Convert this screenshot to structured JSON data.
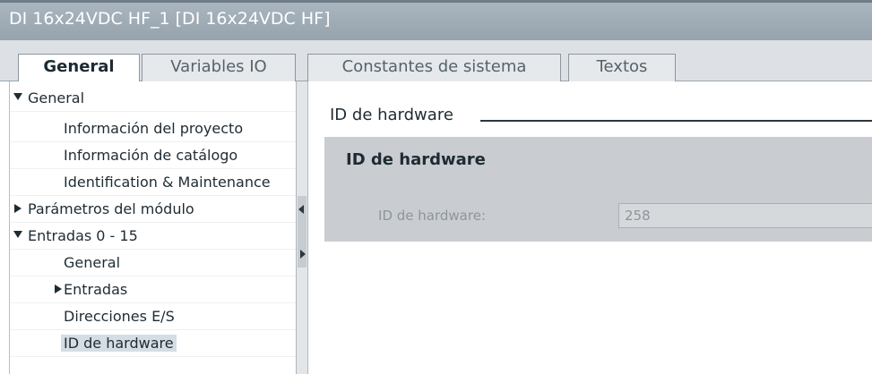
{
  "window": {
    "title": "DI 16x24VDC HF_1 [DI 16x24VDC HF]"
  },
  "tabs": [
    {
      "label": "General",
      "active": true
    },
    {
      "label": "Variables IO",
      "active": false
    },
    {
      "label": "Constantes de sistema",
      "active": false
    },
    {
      "label": "Textos",
      "active": false
    }
  ],
  "nav": {
    "items": [
      {
        "label": "General",
        "expander": "expanded"
      },
      {
        "label": "Información del proyecto",
        "expander": "none"
      },
      {
        "label": "Información de catálogo",
        "expander": "none"
      },
      {
        "label": "Identification & Maintenance",
        "expander": "none"
      },
      {
        "label": "Parámetros del módulo",
        "expander": "collapsed"
      },
      {
        "label": "Entradas 0 - 15",
        "expander": "expanded"
      },
      {
        "label": "General",
        "expander": "none"
      },
      {
        "label": "Entradas",
        "expander": "collapsed"
      },
      {
        "label": "Direcciones E/S",
        "expander": "none"
      },
      {
        "label": "ID de hardware",
        "expander": "none",
        "selected": true
      }
    ]
  },
  "content": {
    "section_title": "ID de hardware",
    "group": {
      "title": "ID de hardware",
      "field_label": "ID de hardware:",
      "field_value": "258"
    }
  },
  "colors": {
    "titlebar": "#9fabb5",
    "tabstrip": "#dde1e5",
    "group_background": "#c9cdd1",
    "selection": "#d5dde4"
  }
}
